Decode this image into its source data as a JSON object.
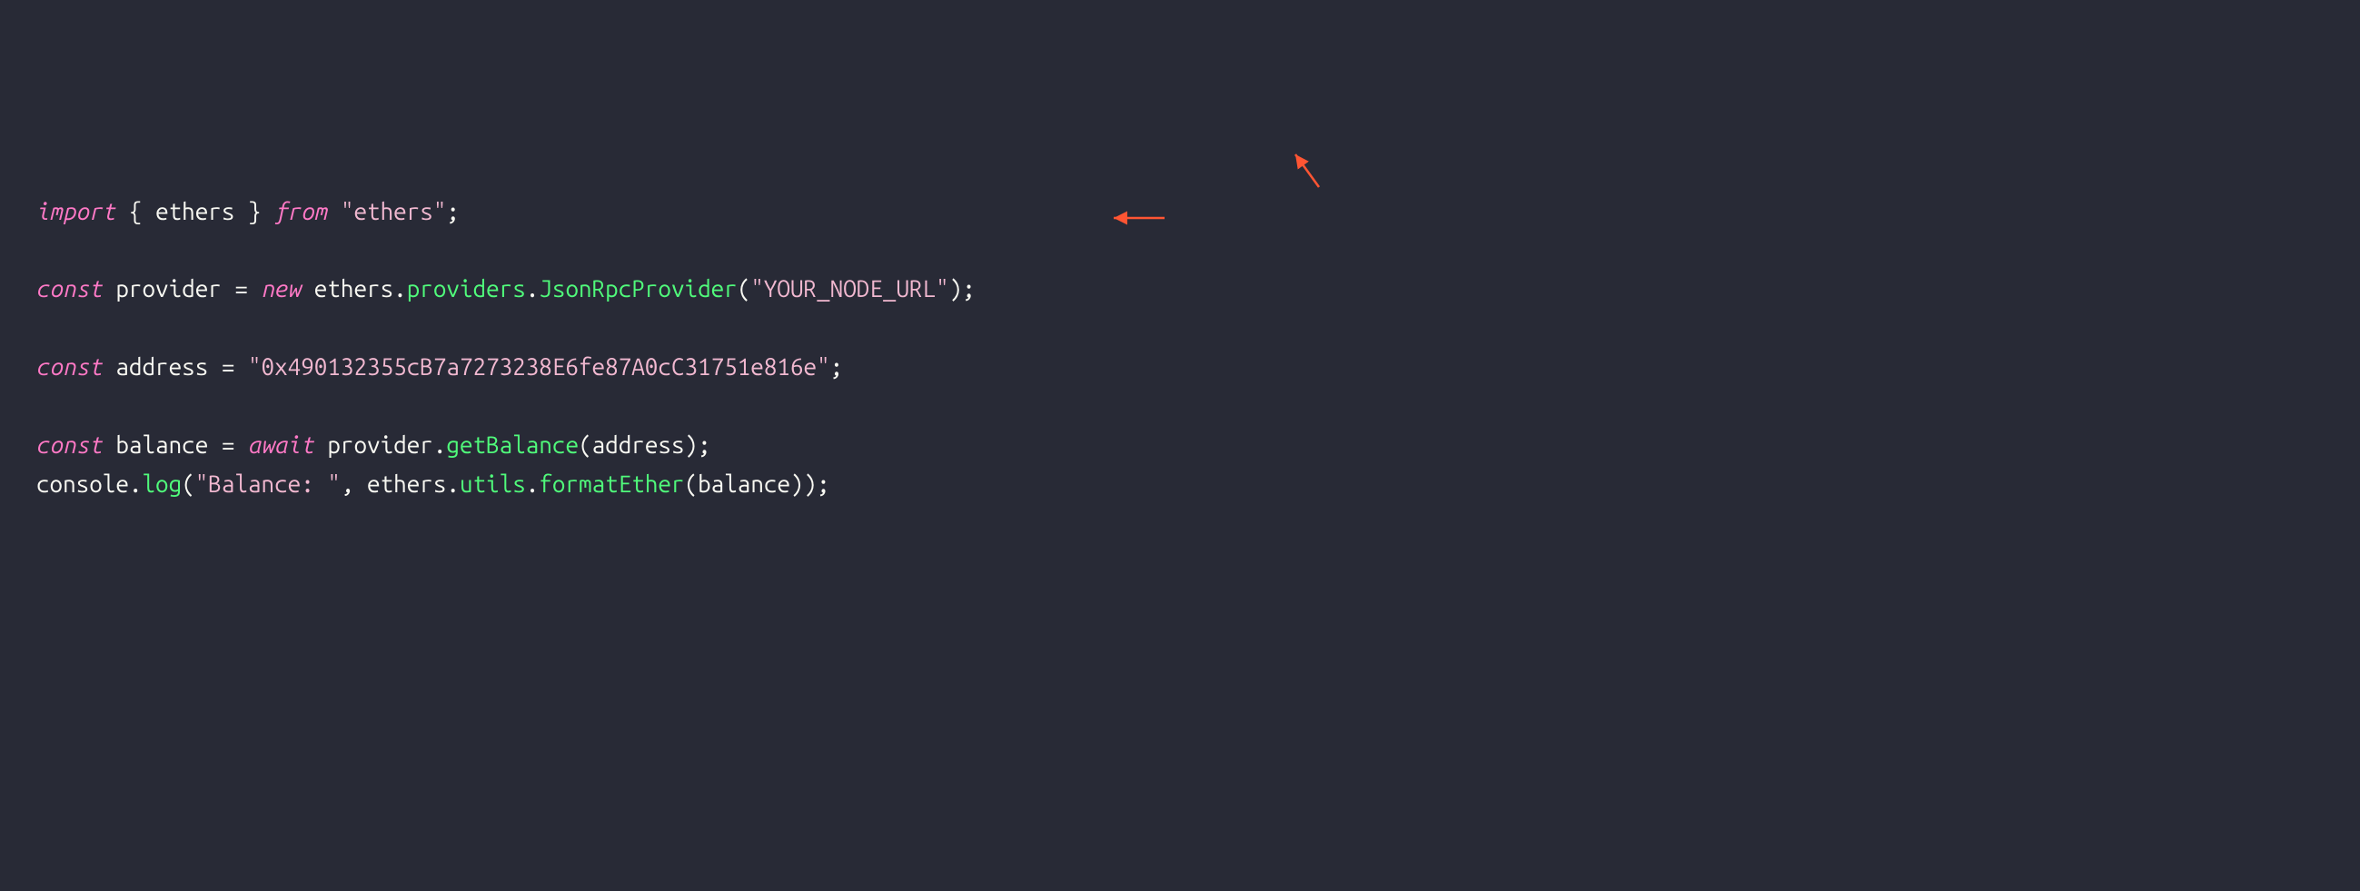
{
  "code": {
    "import_kw": "import",
    "import_open": " { ",
    "import_name": "ethers",
    "import_close": " } ",
    "from_kw": "from",
    "import_str": "\"ethers\"",
    "semi": ";",
    "const_kw": "const",
    "provider": " provider ",
    "eq": "= ",
    "new_kw": "new",
    "sp": " ",
    "ethers_obj": "ethers",
    "dot": ".",
    "providers_prop": "providers",
    "jsonrpc": "JsonRpcProvider",
    "paren_open": "(",
    "node_url_str": "\"YOUR_NODE_URL\"",
    "paren_close": ")",
    "address": " address ",
    "address_str": "\"0x490132355cB7a7273238E6fe87A0cC31751e816e\"",
    "balance": " balance ",
    "await_kw": "await",
    "providerCall": " provider",
    "getBalance": "getBalance",
    "address_arg": "address",
    "console": "console",
    "log": "log",
    "balance_label": "\"Balance: \"",
    "comma": ", ",
    "utils": "utils",
    "formatEther": "formatEther",
    "balance_arg": "balance"
  }
}
